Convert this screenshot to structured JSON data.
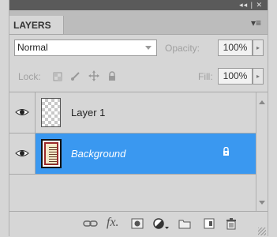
{
  "window": {
    "controls": "◂◂ | ✕"
  },
  "tabs": {
    "active_label": "LAYERS",
    "menu_glyph": "▾≡"
  },
  "blend": {
    "mode": "Normal",
    "opacity_label": "Opacity:",
    "opacity_value": "100%",
    "fill_label": "Fill:",
    "fill_value": "100%",
    "step_glyph": "▸"
  },
  "lock": {
    "label": "Lock:",
    "icons": [
      "lock-transparent-icon",
      "lock-image-icon",
      "lock-position-icon",
      "lock-all-icon"
    ]
  },
  "layers": [
    {
      "name": "Layer 1",
      "visible": true,
      "selected": false,
      "locked": false,
      "thumb": "transparent"
    },
    {
      "name": "Background",
      "visible": true,
      "selected": true,
      "locked": true,
      "thumb": "document"
    }
  ],
  "footer": {
    "icons": [
      "link-layers-icon",
      "fx-icon",
      "layer-mask-icon",
      "adjustment-layer-icon",
      "new-group-icon",
      "new-layer-icon",
      "trash-icon"
    ],
    "fx_label": "fx."
  },
  "colors": {
    "selection": "#3a98f0",
    "panel": "#d6d6d6",
    "titlebar": "#5a5a5a"
  }
}
